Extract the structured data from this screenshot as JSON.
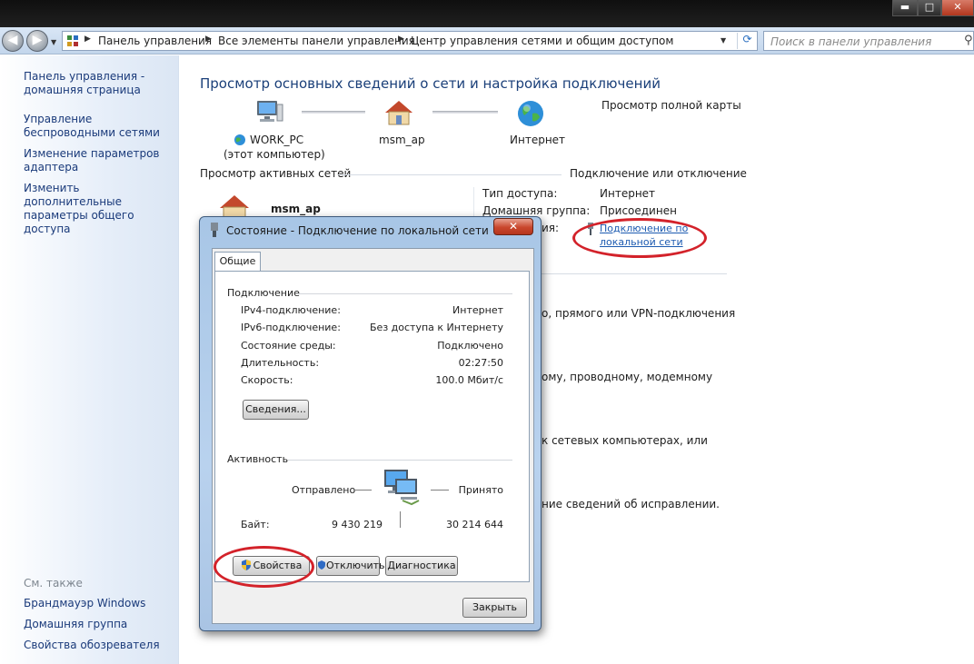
{
  "window": {
    "minimize": "▬",
    "maximize": "□",
    "close": "✕"
  },
  "address": {
    "segments": [
      "Панель управления",
      "Все элементы панели управления",
      "Центр управления сетями и общим доступом"
    ],
    "search_placeholder": "Поиск в панели управления"
  },
  "sidebar": {
    "items": [
      {
        "label": "Панель управления - домашняя страница"
      },
      {
        "label": "Управление беспроводными сетями"
      },
      {
        "label": "Изменение параметров адаптера"
      },
      {
        "label": "Изменить дополнительные параметры общего доступа"
      }
    ],
    "see_also_title": "См. также",
    "see_also": [
      {
        "label": "Брандмауэр Windows"
      },
      {
        "label": "Домашняя группа"
      },
      {
        "label": "Свойства обозревателя"
      }
    ]
  },
  "main": {
    "title": "Просмотр основных сведений о сети и настройка подключений",
    "full_map_link": "Просмотр полной карты",
    "map": {
      "computer_name": "WORK_PC",
      "computer_sub": "(этот компьютер)",
      "network_name": "msm_ap",
      "internet": "Интернет"
    },
    "active_networks_title": "Просмотр активных сетей",
    "connect_disconnect_link": "Подключение или отключение",
    "active_network_name": "msm_ap",
    "access_type_label": "Тип доступа:",
    "access_type_value": "Интернет",
    "homegroup_label": "Домашняя группа:",
    "homegroup_value": "Присоединен",
    "connections_label_tail": "ия:",
    "connection_link": "Подключение по локальной сети",
    "frag1": "о, прямого или VPN-подключения",
    "frag2": "ому, проводному, модемному",
    "frag3": "к сетевых компьютерах, или",
    "frag4": "ние сведений об исправлении."
  },
  "dialog": {
    "title": "Состояние - Подключение по локальной сети",
    "tab_general": "Общие",
    "connection_group": "Подключение",
    "rows": [
      {
        "label": "IPv4-подключение:",
        "value": "Интернет"
      },
      {
        "label": "IPv6-подключение:",
        "value": "Без доступа к Интернету"
      },
      {
        "label": "Состояние среды:",
        "value": "Подключено"
      },
      {
        "label": "Длительность:",
        "value": "02:27:50"
      },
      {
        "label": "Скорость:",
        "value": "100.0 Мбит/с"
      }
    ],
    "details_button": "Сведения...",
    "activity_group": "Активность",
    "sent_label": "Отправлено",
    "received_label": "Принято",
    "bytes_label": "Байт:",
    "bytes_sent": "9 430 219",
    "bytes_received": "30 214 644",
    "properties_button": "Свойства",
    "disable_button": "Отключить",
    "diagnose_button": "Диагностика",
    "close_button": "Закрыть"
  }
}
